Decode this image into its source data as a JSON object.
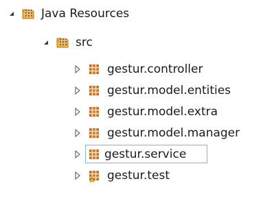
{
  "tree": {
    "root": {
      "label": "Java Resources",
      "icon": "java-resources-folder-icon",
      "expanded": true
    },
    "src": {
      "label": "src",
      "icon": "source-folder-icon",
      "expanded": true
    },
    "packages": [
      {
        "label": "gestur.controller",
        "icon": "package-icon",
        "expanded": false,
        "selected": false
      },
      {
        "label": "gestur.model.entities",
        "icon": "package-icon",
        "expanded": false,
        "selected": false
      },
      {
        "label": "gestur.model.extra",
        "icon": "package-icon",
        "expanded": false,
        "selected": false
      },
      {
        "label": "gestur.model.manager",
        "icon": "package-icon",
        "expanded": false,
        "selected": false
      },
      {
        "label": "gestur.service",
        "icon": "package-icon",
        "expanded": false,
        "selected": true
      },
      {
        "label": "gestur.test",
        "icon": "test-package-icon",
        "expanded": false,
        "selected": false
      }
    ]
  },
  "colors": {
    "selection_border": "#7eb4ea",
    "package_brown": "#8b4a1c",
    "folder_yellow": "#e8b64a"
  }
}
